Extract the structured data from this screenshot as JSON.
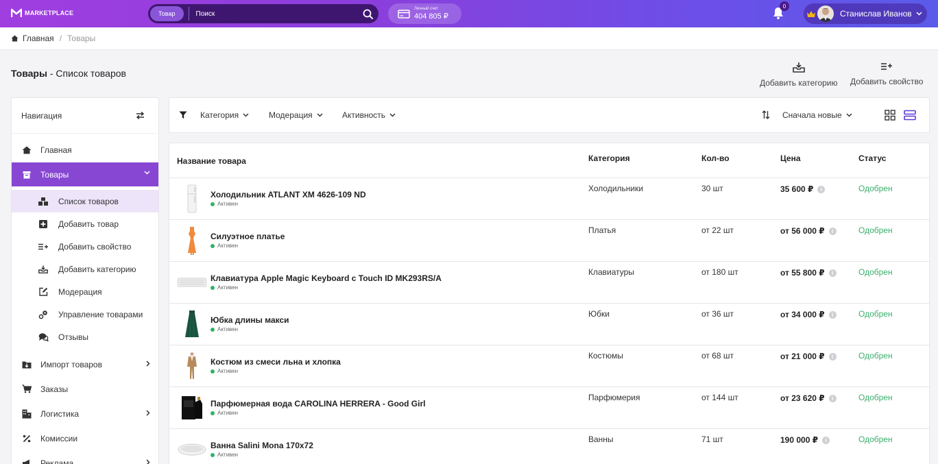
{
  "app": {
    "logo_text": "MARKETPLACE",
    "accent_color": "#8847d3"
  },
  "search": {
    "scope": "Товар",
    "placeholder": "Поиск"
  },
  "account": {
    "label": "Личный счет",
    "amount": "404 805 ₽"
  },
  "notifications": {
    "count": "0"
  },
  "user": {
    "name": "Станислав Иванов"
  },
  "breadcrumb": {
    "home": "Главная",
    "separator": "/",
    "current": "Товары"
  },
  "page": {
    "title_strong": "Товары",
    "title_rest": " - Список товаров"
  },
  "actions": {
    "add_category": "Добавить категорию",
    "add_property": "Добавить свойство"
  },
  "sidebar": {
    "header": "Навигация",
    "items": [
      {
        "label": "Главная",
        "icon": "home-icon"
      },
      {
        "label": "Товары",
        "icon": "box-icon"
      },
      {
        "label": "Импорт товаров",
        "icon": "import-icon"
      },
      {
        "label": "Заказы",
        "icon": "cart-icon"
      },
      {
        "label": "Логистика",
        "icon": "building-icon"
      },
      {
        "label": "Комиссии",
        "icon": "percent-icon"
      },
      {
        "label": "Реклама",
        "icon": "megaphone-icon"
      }
    ],
    "subitems": [
      {
        "label": "Список товаров",
        "icon": "boxes-icon"
      },
      {
        "label": "Добавить товар",
        "icon": "plus-square-icon"
      },
      {
        "label": "Добавить свойство",
        "icon": "list-plus-icon"
      },
      {
        "label": "Добавить категорию",
        "icon": "tray-icon"
      },
      {
        "label": "Модерация",
        "icon": "edit-icon"
      },
      {
        "label": "Управление товарами",
        "icon": "gears-icon"
      },
      {
        "label": "Отзывы",
        "icon": "chat-icon"
      }
    ]
  },
  "filters": {
    "category": "Категория",
    "moderation": "Модерация",
    "activity": "Активность",
    "sort": "Сначала новые"
  },
  "table": {
    "headers": {
      "name": "Название товара",
      "category": "Категория",
      "qty": "Кол-во",
      "price": "Цена",
      "status": "Статус"
    },
    "rows": [
      {
        "name": "Холодильник ATLANT ХМ 4626-109 ND",
        "state": "Активен",
        "category": "Холодильники",
        "qty": "30 шт",
        "price": "35 600 ₽",
        "status": "Одобрен",
        "image": "fridge"
      },
      {
        "name": "Силуэтное платье",
        "state": "Активен",
        "category": "Платья",
        "qty": "от 22 шт",
        "price": "от 56 000 ₽",
        "status": "Одобрен",
        "image": "dress"
      },
      {
        "name": "Клавиатура Apple Magic Keyboard с Touch ID MK293RS/A",
        "state": "Активен",
        "category": "Клавиатуры",
        "qty": "от 180 шт",
        "price": "от 55 800 ₽",
        "status": "Одобрен",
        "image": "keyboard"
      },
      {
        "name": "Юбка длины макси",
        "state": "Активен",
        "category": "Юбки",
        "qty": "от 36 шт",
        "price": "от 34 000 ₽",
        "status": "Одобрен",
        "image": "skirt"
      },
      {
        "name": "Костюм из смеси льна и хлопка",
        "state": "Активен",
        "category": "Костюмы",
        "qty": "от 68 шт",
        "price": "от 21 000 ₽",
        "status": "Одобрен",
        "image": "suit"
      },
      {
        "name": "Парфюмерная вода CAROLINA HERRERA - Good Girl",
        "state": "Активен",
        "category": "Парфюмерия",
        "qty": "от 144 шт",
        "price": "от 23 620 ₽",
        "status": "Одобрен",
        "image": "perfume"
      },
      {
        "name": "Ванна Salini Mona 170x72",
        "state": "Активен",
        "category": "Ванны",
        "qty": "71 шт",
        "price": "190 000 ₽",
        "status": "Одобрен",
        "image": "bathtub"
      }
    ]
  }
}
